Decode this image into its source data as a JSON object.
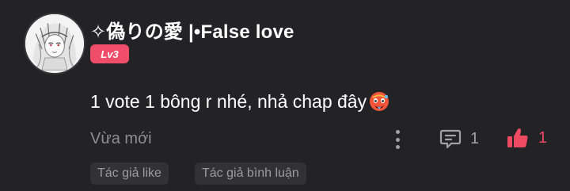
{
  "comment": {
    "username": "✧偽りの愛 |•False love",
    "level": "Lv3",
    "text": "1 vote 1 bông r nhé, nhả chap đây",
    "emoji": "hot-face-emoji",
    "timestamp": "Vừa mới",
    "reply_count": "1",
    "like_count": "1",
    "tags": [
      "Tác giả like",
      "Tác giả bình luận"
    ]
  },
  "colors": {
    "background": "#232325",
    "level_badge": "#f04d6a",
    "like_accent": "#ee4b63",
    "secondary_text": "#8e8e93",
    "tag_background": "#323234"
  }
}
